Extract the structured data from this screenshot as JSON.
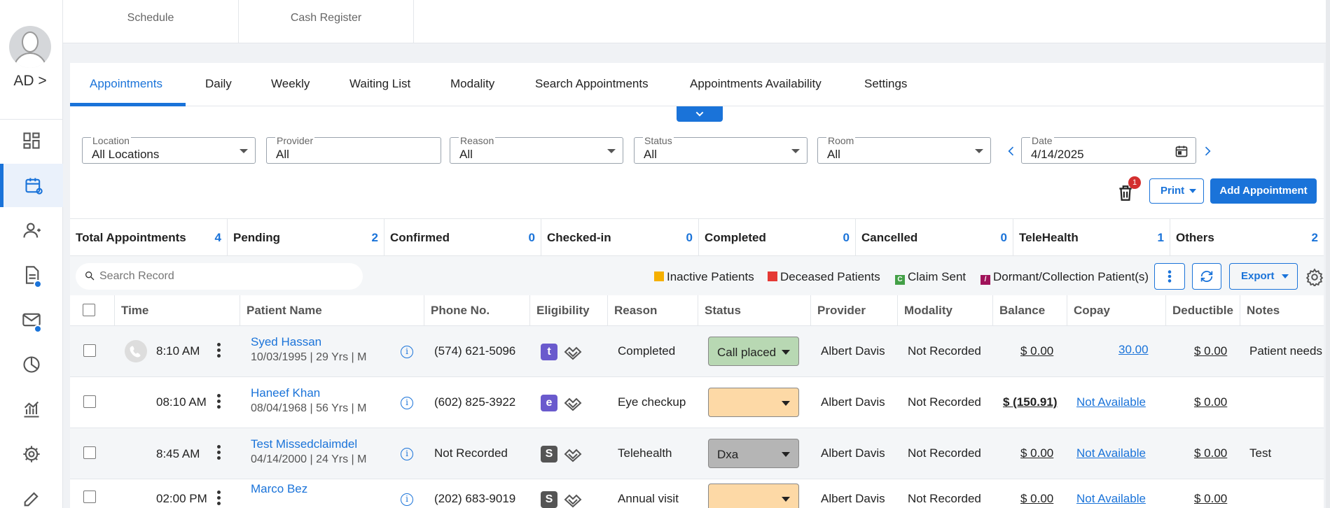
{
  "user": {
    "initials": "AD >"
  },
  "top_tabs": [
    "Schedule",
    "Cash Register"
  ],
  "sub_tabs": [
    "Appointments",
    "Daily",
    "Weekly",
    "Waiting List",
    "Modality",
    "Search Appointments",
    "Appointments Availability",
    "Settings"
  ],
  "filters": {
    "location": {
      "label": "Location",
      "value": "All Locations"
    },
    "provider": {
      "label": "Provider",
      "value": "All"
    },
    "reason": {
      "label": "Reason",
      "value": "All"
    },
    "status": {
      "label": "Status",
      "value": "All"
    },
    "room": {
      "label": "Room",
      "value": "All"
    },
    "date": {
      "label": "Date",
      "value": "4/14/2025"
    }
  },
  "actions": {
    "trash_badge": "1",
    "print": "Print",
    "add": "Add Appointment"
  },
  "stats": [
    {
      "label": "Total Appointments",
      "value": "4"
    },
    {
      "label": "Pending",
      "value": "2"
    },
    {
      "label": "Confirmed",
      "value": "0"
    },
    {
      "label": "Checked-in",
      "value": "0"
    },
    {
      "label": "Completed",
      "value": "0"
    },
    {
      "label": "Cancelled",
      "value": "0"
    },
    {
      "label": "TeleHealth",
      "value": "1"
    },
    {
      "label": "Others",
      "value": "2"
    }
  ],
  "search": {
    "placeholder": "Search Record"
  },
  "legend": [
    {
      "label": "Inactive Patients",
      "color": "#f5b000"
    },
    {
      "label": "Deceased Patients",
      "color": "#e53935"
    },
    {
      "label": "Claim Sent",
      "color": "#43a047",
      "letter": "C"
    },
    {
      "label": "Dormant/Collection Patient(s)",
      "color": "#a0135a",
      "letter": "/"
    }
  ],
  "export": "Export",
  "columns": [
    "Time",
    "Patient Name",
    "Phone No.",
    "Eligibility",
    "Reason",
    "Status",
    "Provider",
    "Modality",
    "Balance",
    "Copay",
    "Deductible",
    "Notes"
  ],
  "rows": [
    {
      "time": "8:10 AM",
      "name": "Syed Hassan",
      "info": "10/03/1995 | 29 Yrs | M",
      "phone": "(574) 621-5096",
      "elig": "t",
      "elig_color": "#6a5acd",
      "reason": "Completed",
      "status": "Call placed",
      "status_color": "#b8d8b3",
      "provider": "Albert Davis",
      "modality": "Not Recorded",
      "balance": "$ 0.00",
      "copay": "30.00",
      "deductible": "$ 0.00",
      "notes": "Patient needs"
    },
    {
      "time": "08:10 AM",
      "name": "Haneef Khan",
      "info": "08/04/1968 | 56 Yrs | M",
      "phone": "(602) 825-3922",
      "elig": "e",
      "elig_color": "#6a5acd",
      "reason": "Eye checkup",
      "status": "",
      "status_color": "#fdd9a6",
      "provider": "Albert Davis",
      "modality": "Not Recorded",
      "balance": "$ (150.91)",
      "copay": "Not Available",
      "deductible": "$ 0.00",
      "notes": ""
    },
    {
      "time": "8:45 AM",
      "name": "Test Missedclaimdel",
      "info": "04/14/2000 | 24 Yrs | M",
      "phone": "Not Recorded",
      "elig": "S",
      "elig_color": "#555555",
      "reason": "Telehealth",
      "status": "Dxa",
      "status_color": "#b5b5b5",
      "provider": "Albert Davis",
      "modality": "Not Recorded",
      "balance": "$ 0.00",
      "copay": "Not Available",
      "deductible": "$ 0.00",
      "notes": "Test"
    },
    {
      "time": "02:00 PM",
      "name": "Marco Bez",
      "info": "",
      "phone": "(202) 683-9019",
      "elig": "S",
      "elig_color": "#555555",
      "reason": "Annual visit",
      "status": "",
      "status_color": "#fdd9a6",
      "provider": "Albert Davis",
      "modality": "Not Recorded",
      "balance": "$ 0.00",
      "copay": "Not Available",
      "deductible": "$ 0.00",
      "notes": ""
    }
  ]
}
